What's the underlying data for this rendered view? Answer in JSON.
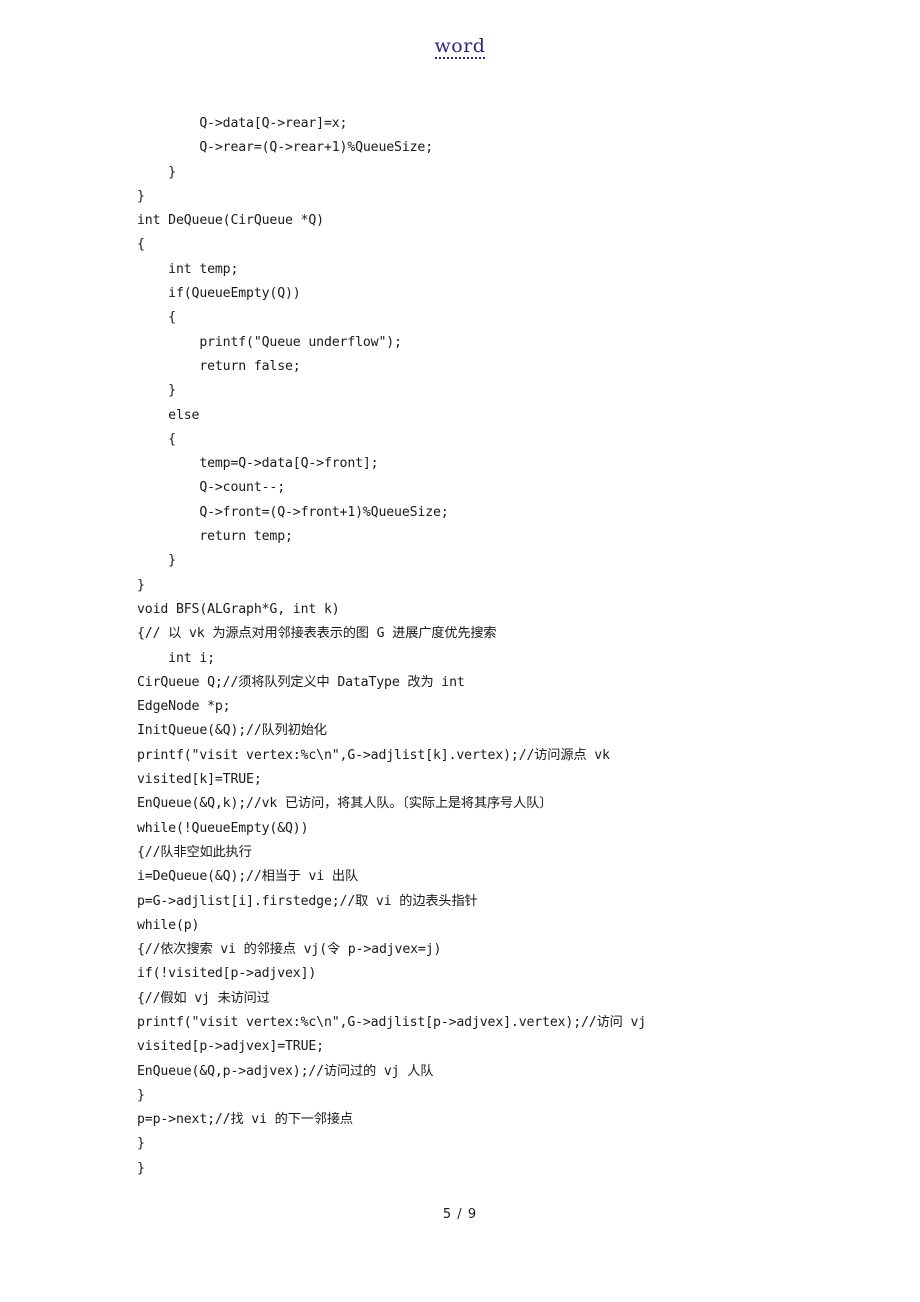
{
  "header": {
    "watermark": "word"
  },
  "footer": {
    "page_number": "5 / 9"
  },
  "document": {
    "lines": [
      "        Q->data[Q->rear]=x;",
      "        Q->rear=(Q->rear+1)%QueueSize;",
      "    }",
      "}",
      "int DeQueue(CirQueue *Q)",
      "{",
      "    int temp;",
      "    if(QueueEmpty(Q))",
      "    {",
      "        printf(\"Queue underflow\");",
      "        return false;",
      "    }",
      "    else",
      "    {",
      "        temp=Q->data[Q->front];",
      "        Q->count--;",
      "        Q->front=(Q->front+1)%QueueSize;",
      "        return temp;",
      "    }",
      "}",
      "void BFS(ALGraph*G, int k)",
      "{// 以 vk 为源点对用邻接表表示的图 G 进展广度优先搜索",
      "    int i;",
      "CirQueue Q;//须将队列定义中 DataType 改为 int",
      "EdgeNode *p;",
      "InitQueue(&Q);//队列初始化",
      "printf(\"visit vertex:%c\\n\",G->adjlist[k].vertex);//访问源点 vk",
      "visited[k]=TRUE;",
      "EnQueue(&Q,k);//vk 已访问，将其人队。〔实际上是将其序号人队〕",
      "while(!QueueEmpty(&Q))",
      "{//队非空如此执行",
      "i=DeQueue(&Q);//相当于 vi 出队",
      "p=G->adjlist[i].firstedge;//取 vi 的边表头指针",
      "while(p)",
      "{//依次搜索 vi 的邻接点 vj(令 p->adjvex=j)",
      "if(!visited[p->adjvex])",
      "{//假如 vj 未访问过",
      "printf(\"visit vertex:%c\\n\",G->adjlist[p->adjvex].vertex);//访问 vj",
      "visited[p->adjvex]=TRUE;",
      "EnQueue(&Q,p->adjvex);//访问过的 vj 人队",
      "}",
      "p=p->next;//找 vi 的下一邻接点",
      "}",
      "}"
    ]
  }
}
